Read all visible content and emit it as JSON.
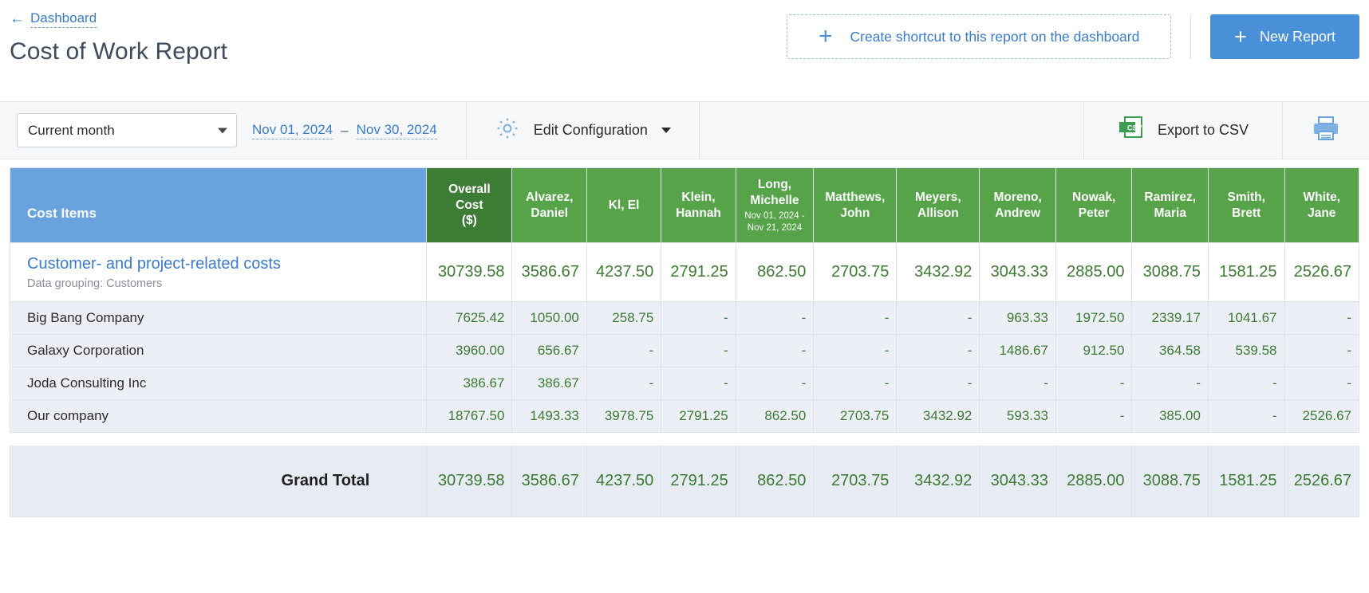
{
  "header": {
    "back_arrow": "←",
    "breadcrumb": "Dashboard",
    "title": "Cost of Work Report",
    "shortcut_button": "Create shortcut to this report on the dashboard",
    "shortcut_plus": "+",
    "new_report_button": "New Report",
    "new_report_plus": "+",
    "accent_blue": "#4a90d9"
  },
  "toolbar": {
    "period_selected": "Current month",
    "period_options": [
      "Current month"
    ],
    "date_from": "Nov 01, 2024",
    "date_dash": "–",
    "date_to": "Nov 30, 2024",
    "edit_configuration": "Edit Configuration",
    "export_csv": "Export to CSV",
    "csv_icon_text": "CSV"
  },
  "table": {
    "first_column_header": "Cost Items",
    "overall_header_line1": "Overall",
    "overall_header_line2": "Cost",
    "overall_header_line3": "($)",
    "columns": [
      {
        "name": "Alvarez,\nDaniel",
        "line1": "Alvarez,",
        "line2": "Daniel",
        "sub": ""
      },
      {
        "name": "Kl, El",
        "line1": "Kl, El",
        "line2": "",
        "sub": ""
      },
      {
        "name": "Klein,\nHannah",
        "line1": "Klein,",
        "line2": "Hannah",
        "sub": ""
      },
      {
        "name": "Long,\nMichelle",
        "line1": "Long,",
        "line2": "Michelle",
        "sub": "Nov 01, 2024 - Nov 21, 2024"
      },
      {
        "name": "Matthews,\nJohn",
        "line1": "Matthews,",
        "line2": "John",
        "sub": ""
      },
      {
        "name": "Meyers,\nAllison",
        "line1": "Meyers,",
        "line2": "Allison",
        "sub": ""
      },
      {
        "name": "Moreno,\nAndrew",
        "line1": "Moreno,",
        "line2": "Andrew",
        "sub": ""
      },
      {
        "name": "Nowak,\nPeter",
        "line1": "Nowak,",
        "line2": "Peter",
        "sub": ""
      },
      {
        "name": "Ramirez,\nMaria",
        "line1": "Ramirez,",
        "line2": "Maria",
        "sub": ""
      },
      {
        "name": "Smith,\nBrett",
        "line1": "Smith,",
        "line2": "Brett",
        "sub": ""
      },
      {
        "name": "White,\nJane",
        "line1": "White,",
        "line2": "Jane",
        "sub": ""
      }
    ],
    "group_row": {
      "title": "Customer- and project-related costs",
      "subtitle": "Data grouping: Customers",
      "overall": "30739.58",
      "values": [
        "3586.67",
        "4237.50",
        "2791.25",
        "862.50",
        "2703.75",
        "3432.92",
        "3043.33",
        "2885.00",
        "3088.75",
        "1581.25",
        "2526.67"
      ]
    },
    "rows": [
      {
        "label": "Big Bang Company",
        "overall": "7625.42",
        "values": [
          "1050.00",
          "258.75",
          "-",
          "-",
          "-",
          "-",
          "963.33",
          "1972.50",
          "2339.17",
          "1041.67",
          "-"
        ]
      },
      {
        "label": "Galaxy Corporation",
        "overall": "3960.00",
        "values": [
          "656.67",
          "-",
          "-",
          "-",
          "-",
          "-",
          "1486.67",
          "912.50",
          "364.58",
          "539.58",
          "-"
        ]
      },
      {
        "label": "Joda Consulting Inc",
        "overall": "386.67",
        "values": [
          "386.67",
          "-",
          "-",
          "-",
          "-",
          "-",
          "-",
          "-",
          "-",
          "-",
          "-"
        ]
      },
      {
        "label": "Our company",
        "overall": "18767.50",
        "values": [
          "1493.33",
          "3978.75",
          "2791.25",
          "862.50",
          "2703.75",
          "3432.92",
          "593.33",
          "-",
          "385.00",
          "-",
          "2526.67"
        ]
      }
    ],
    "grand_total": {
      "label": "Grand Total",
      "overall": "30739.58",
      "values": [
        "3586.67",
        "4237.50",
        "2791.25",
        "862.50",
        "2703.75",
        "3432.92",
        "3043.33",
        "2885.00",
        "3088.75",
        "1581.25",
        "2526.67"
      ]
    }
  }
}
